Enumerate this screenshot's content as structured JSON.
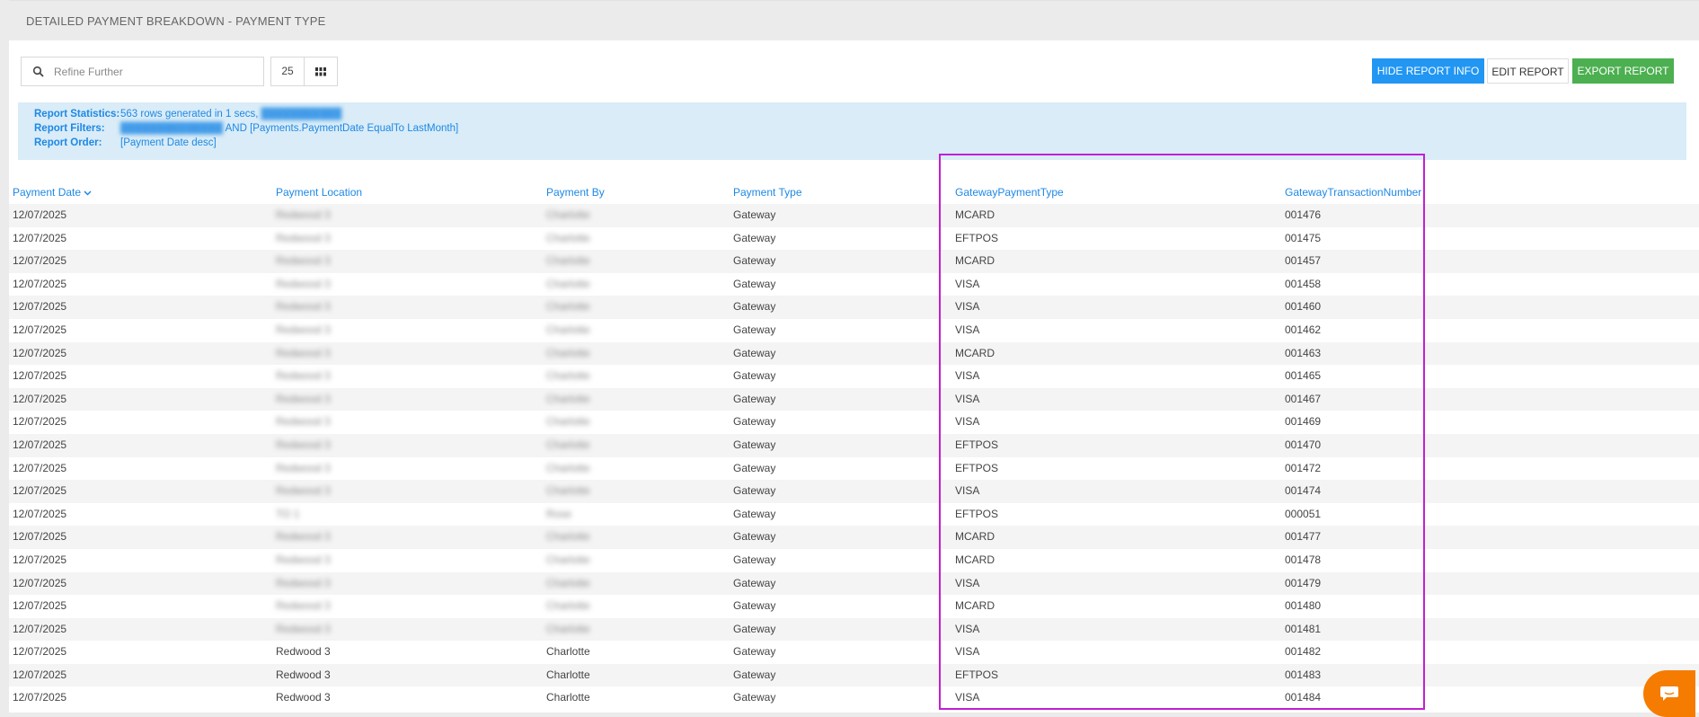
{
  "header": {
    "title": "DETAILED PAYMENT BREAKDOWN - PAYMENT TYPE"
  },
  "toolbar": {
    "search_placeholder": "Refine Further",
    "page_size": "25",
    "hide_label": "HIDE REPORT INFO",
    "edit_label": "EDIT REPORT",
    "export_label": "EXPORT REPORT"
  },
  "report_info": {
    "stats_label": "Report Statistics:",
    "stats_value": "563 rows generated in 1 secs,",
    "filters_label": "Report Filters:",
    "filters_value": "AND [Payments.PaymentDate EqualTo LastMonth]",
    "order_label": "Report Order:",
    "order_value": "[Payment Date desc]"
  },
  "table": {
    "columns": [
      "Payment Date",
      "Payment Location",
      "Payment By",
      "Payment Type",
      "GatewayPaymentType",
      "GatewayTransactionNumber"
    ],
    "rows": [
      [
        "12/07/2025",
        "Redwood 3",
        "Charlotte",
        "Gateway",
        "MCARD",
        "001476"
      ],
      [
        "12/07/2025",
        "Redwood 3",
        "Charlotte",
        "Gateway",
        "EFTPOS",
        "001475"
      ],
      [
        "12/07/2025",
        "Redwood 3",
        "Charlotte",
        "Gateway",
        "MCARD",
        "001457"
      ],
      [
        "12/07/2025",
        "Redwood 3",
        "Charlotte",
        "Gateway",
        "VISA",
        "001458"
      ],
      [
        "12/07/2025",
        "Redwood 3",
        "Charlotte",
        "Gateway",
        "VISA",
        "001460"
      ],
      [
        "12/07/2025",
        "Redwood 3",
        "Charlotte",
        "Gateway",
        "VISA",
        "001462"
      ],
      [
        "12/07/2025",
        "Redwood 3",
        "Charlotte",
        "Gateway",
        "MCARD",
        "001463"
      ],
      [
        "12/07/2025",
        "Redwood 3",
        "Charlotte",
        "Gateway",
        "VISA",
        "001465"
      ],
      [
        "12/07/2025",
        "Redwood 3",
        "Charlotte",
        "Gateway",
        "VISA",
        "001467"
      ],
      [
        "12/07/2025",
        "Redwood 3",
        "Charlotte",
        "Gateway",
        "VISA",
        "001469"
      ],
      [
        "12/07/2025",
        "Redwood 3",
        "Charlotte",
        "Gateway",
        "EFTPOS",
        "001470"
      ],
      [
        "12/07/2025",
        "Redwood 3",
        "Charlotte",
        "Gateway",
        "EFTPOS",
        "001472"
      ],
      [
        "12/07/2025",
        "Redwood 3",
        "Charlotte",
        "Gateway",
        "VISA",
        "001474"
      ],
      [
        "12/07/2025",
        "TO 1",
        "Rose",
        "Gateway",
        "EFTPOS",
        "000051"
      ],
      [
        "12/07/2025",
        "Redwood 3",
        "Charlotte",
        "Gateway",
        "MCARD",
        "001477"
      ],
      [
        "12/07/2025",
        "Redwood 3",
        "Charlotte",
        "Gateway",
        "MCARD",
        "001478"
      ],
      [
        "12/07/2025",
        "Redwood 3",
        "Charlotte",
        "Gateway",
        "VISA",
        "001479"
      ],
      [
        "12/07/2025",
        "Redwood 3",
        "Charlotte",
        "Gateway",
        "MCARD",
        "001480"
      ],
      [
        "12/07/2025",
        "Redwood 3",
        "Charlotte",
        "Gateway",
        "VISA",
        "001481"
      ],
      [
        "12/07/2025",
        "Redwood 3",
        "Charlotte",
        "Gateway",
        "VISA",
        "001482"
      ],
      [
        "12/07/2025",
        "Redwood 3",
        "Charlotte",
        "Gateway",
        "EFTPOS",
        "001483"
      ],
      [
        "12/07/2025",
        "Redwood 3",
        "Charlotte",
        "Gateway",
        "VISA",
        "001484"
      ]
    ],
    "blurred_rows": 19
  },
  "colors": {
    "accent": "#1e88e5",
    "hide_button": "#2196f3",
    "export_button": "#4caf50",
    "highlight": "#c21fd1",
    "chat": "#f57c00"
  },
  "icons": [
    "search-icon",
    "grid-icon",
    "chevron-down-icon",
    "chat-icon"
  ]
}
